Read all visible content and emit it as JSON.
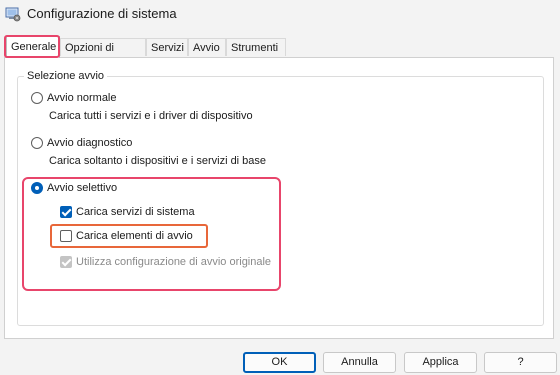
{
  "window": {
    "title": "Configurazione di sistema"
  },
  "tabs": [
    {
      "label": "Generale",
      "active": true
    },
    {
      "label": "Opzioni di avvio",
      "active": false
    },
    {
      "label": "Servizi",
      "active": false
    },
    {
      "label": "Avvio",
      "active": false
    },
    {
      "label": "Strumenti",
      "active": false
    }
  ],
  "startup": {
    "group_label": "Selezione avvio",
    "normal": {
      "label": "Avvio normale",
      "desc": "Carica tutti i servizi e i driver di dispositivo",
      "selected": false
    },
    "diagnostic": {
      "label": "Avvio diagnostico",
      "desc": "Carica soltanto i dispositivi e i servizi di base",
      "selected": false
    },
    "selective": {
      "label": "Avvio selettivo",
      "selected": true,
      "options": {
        "system_services": {
          "label": "Carica servizi di sistema",
          "checked": true,
          "enabled": true
        },
        "startup_items": {
          "label": "Carica elementi di avvio",
          "checked": false,
          "enabled": true
        },
        "original_boot": {
          "label": "Utilizza configurazione di avvio originale",
          "checked": true,
          "enabled": false
        }
      }
    }
  },
  "buttons": {
    "ok": "OK",
    "cancel": "Annulla",
    "apply": "Applica",
    "help": "?"
  },
  "colors": {
    "accent": "#005fb8",
    "highlight": "#e8456b",
    "highlight_secondary": "#e8673a"
  }
}
